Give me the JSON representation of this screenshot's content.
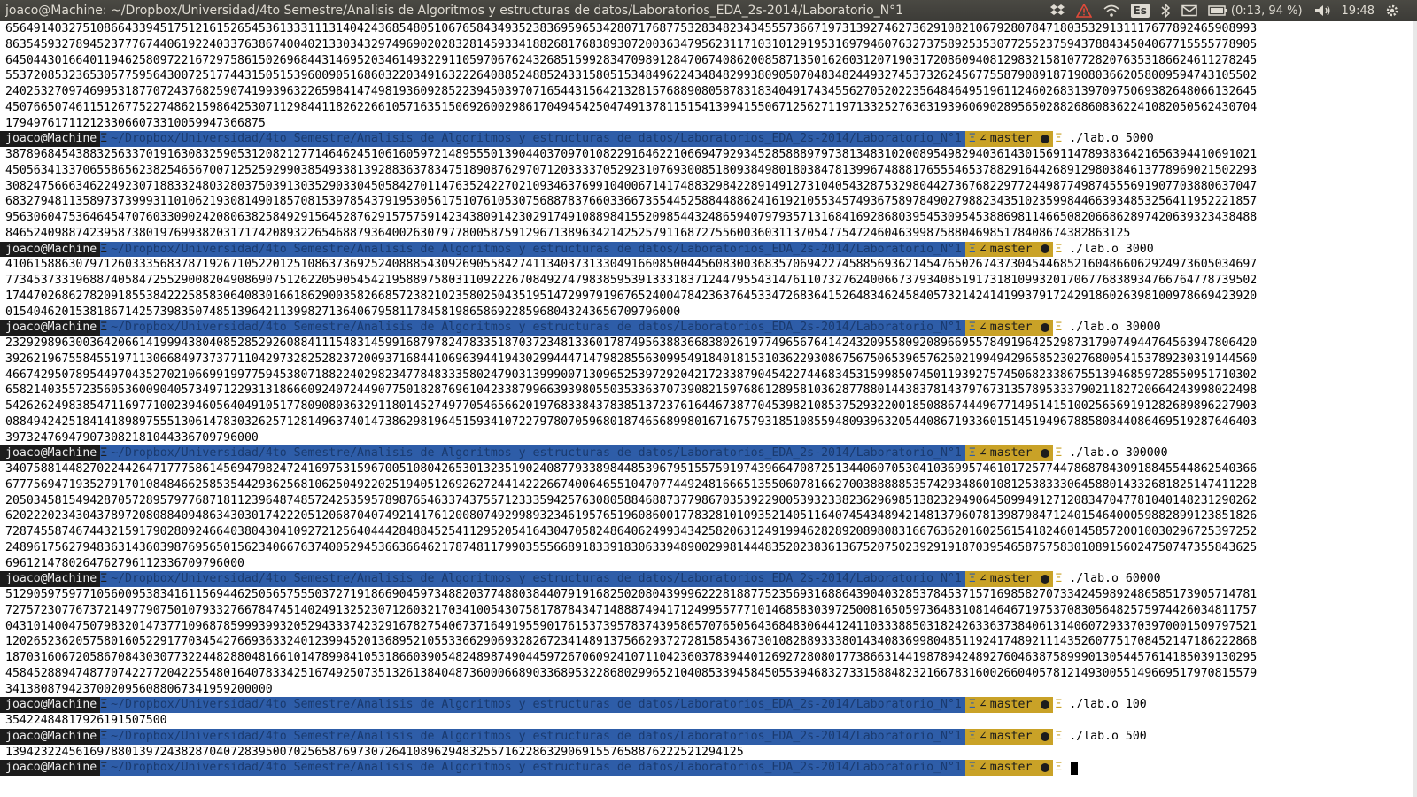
{
  "window": {
    "title": "joaco@Machine: ~/Dropbox/Universidad/4to Semestre/Analisis de Algoritmos y estructuras de datos/Laboratorios_EDA_2s-2014/Laboratorio_N°1"
  },
  "indicators": {
    "keyboard_layout": "Es",
    "battery": "(0:13, 94 %)",
    "clock": "19:48"
  },
  "icons": [
    "dropbox-icon",
    "alert-icon",
    "wifi-icon",
    "keyboard-icon",
    "bluetooth-icon",
    "mail-icon",
    "battery-icon",
    "volume-icon",
    "gear-icon"
  ],
  "colors": {
    "user_segment": "#1c1c1c",
    "path_segment": "#2e5da8",
    "git_segment": "#c9a227"
  },
  "prompt": {
    "user": "joaco@Machine",
    "separator": "Ξ",
    "path": "~/Dropbox/Universidad/4to Semestre/Analisis de Algoritmos y estructuras de datos/Laboratorios_EDA_2s-2014/Laboratorio_N°1",
    "branch": "master",
    "branch_glyph": "∠"
  },
  "terminal": {
    "lines": [
      {
        "type": "output",
        "text": "6564914032751086643394517512161526545361333111314042436854805106765843493523836959653428071768775328348234345557366719731392746273629108210679280784718035329131117677892465908993"
      },
      {
        "type": "output",
        "text": "8635459327894523777674406192240337638674004021330343297496902028328145933418826817683893072003634795623117103101291953169794607632737589253530772552375943788434504067715555778905"
      },
      {
        "type": "output",
        "text": "6450443016640119462580972216729758615026968443146952034614932291105970676243268515992834709891284706740862008587135016260312071903172086094081298321581077282076353186624611278245"
      },
      {
        "type": "output",
        "text": "5537208532365305775956430072517744315051539600905168603220349163222640885248852433158051534849622434848299380905070483482449327453732624567755879089187190803662058009594743105502"
      },
      {
        "type": "output",
        "text": "2402532709746995318770724376825907419939632265984147498193609285223945039707165443156421328157688908058783183404917434556270520223564846495196112460268313970975069382648066132645"
      },
      {
        "type": "output",
        "text": "4507665074611512677522748621598642530711298441182622661057163515069260029861704945425047491378115154139941550671256271197133252763631939606902895650288268608362241082050562430704"
      },
      {
        "type": "output",
        "text": "1794976171121233066073310059947366875"
      },
      {
        "type": "prompt",
        "cmd": "./lab.o 5000"
      },
      {
        "type": "output",
        "text": "3878968454388325633701916308325905312082127714646245106160597214895550139044037097010822916462210669479293452858889797381348310200895498294036143015691147893836421656394410691021"
      },
      {
        "type": "output",
        "text": "4505634133706558656238254656700712525929903854933813928836378347518908762970712033337052923107693008518093849801803847813996748881765554653788291644268912980384613778969021502293"
      },
      {
        "type": "output",
        "text": "3082475666346224923071883324803280375039130352903304505842701147635242270210934637699104006714174883298422891491273104054328753298044273676822977244987749874555691907703880637047"
      },
      {
        "type": "output",
        "text": "6832794811358973739993110106219308149018570815397854379195305617510761053075688783766033667355445258844886241619210553457493675897849027988234351023599844663934853256411952221857"
      },
      {
        "type": "output",
        "text": "9563060475364645470760330902420806382584929156452876291575759142343809142302917491088984155209854432486594079793571316841692868039545309545388698114665082066862897420639323438488"
      },
      {
        "type": "output",
        "text": "8465240988742395873801976993820317174208932265468879364002630797780058759129671389634214252579116872755600360311370547754724604639987588046985178408674382863125"
      },
      {
        "type": "prompt",
        "cmd": "./lab.o 3000"
      },
      {
        "type": "output",
        "text": "4106158863079712603335683787192671052201251086373692524088854309269055842741134037313304916608500445608300368357069422745885693621454765026743730454468521604866062924973605034697"
      },
      {
        "type": "output",
        "text": "7734537331968874058472552900820490869075126220590545421958897580311092226708492747983859539133318371244795543147611073276240066737934085191731810993201706776838934766764778739502"
      },
      {
        "type": "output",
        "text": "1744702686278209185538422258583064083016618629003582668572382102358025043519514729979196765240047842363764533472683641526483462458405732142414199379172429186026398100978669423920"
      },
      {
        "type": "output",
        "text": "015404620153818671425739835074851396421139982713640679581178458198658692285968043243656709796000"
      },
      {
        "type": "prompt",
        "cmd": "./lab.o 30000"
      },
      {
        "type": "output",
        "text": "2329298963003642066141999438040852852926088411154831459916879782478335187037234813360178749563883668380261977496567641424320955809208966955784919642529873179074944764563947806420"
      },
      {
        "type": "output",
        "text": "3926219675584551971130668497373771104297328252823720093716844106963944194302994447147982855630995491840181531036229308675675065396576250219949429658523027680054153789230319144560"
      },
      {
        "type": "output",
        "text": "4667429507895449704352702106699199775945380718822402982347784833358024790313999007130965253972920421723387904542274468345315998507450119392757450682338675513946859728550951710302"
      },
      {
        "type": "output",
        "text": "6582140355723560536009040573497122931318666092407244907750182876961042338799663939805503533637073908215976861289581036287788014438378143797673135789533379021182720664243998022498"
      },
      {
        "type": "output",
        "text": "5426262498385471169771002394605640491051778090803632911801452749770546566201976833843783851372376164467387704539821085375293220018508867444967714951415100256569191282689896227903"
      },
      {
        "type": "output",
        "text": "0884942425184141898975551306147830326257128149637401473862981964515934107227978070596801874656899801671675793185108559480939632054408671933601514519496788580844086469519287646403"
      },
      {
        "type": "output",
        "text": "397324769479073082181044336709796000"
      },
      {
        "type": "prompt",
        "cmd": "./lab.o 300000"
      },
      {
        "type": "output",
        "text": "3407588144827022442647177758614569479824724169753159670051080426530132351902408779338984485396795155759197439664708725134406070530410369957461017257744786878430918845544862540366"
      },
      {
        "type": "output",
        "text": "6777569471935279170108484662585354429362568106250492202519405126926272441422266740064655104707744924816665135506078166270038888853574293486010812538333064588014332681825147411228"
      },
      {
        "type": "output",
        "text": "2050345815494287057289579776871811239648748572425359578987654633743755712333594257630805884688737798670353922900539323382362969851382329490645099491271208347047781040148231290262"
      },
      {
        "type": "output",
        "text": "6202220234304378972080884094863430301742220512068704074921417612008074929989323461957651960860017783281010935214051164074543489421481379607813987984712401546400059882899123851826"
      },
      {
        "type": "output",
        "text": "7287455874674432159179028092466403804304109272125640444284884525411295205416430470582486406249934342582063124919946282892089808316676362016025615418246014585720010030296725397252"
      },
      {
        "type": "output",
        "text": "2489617562794836314360398769565015623406676374005294536636646217874811799035556689183391830633948900299814448352023836136752075023929191870395465875758301089156024750747355843625"
      },
      {
        "type": "output",
        "text": "6961214780264762796112336709796000"
      },
      {
        "type": "prompt",
        "cmd": "./lab.o 60000"
      },
      {
        "type": "output",
        "text": "5129059759771056009538341611569446250565755503727191866904597348820377488038440791916825020804399962228188775235693168864390403285378453715716985827073342459892486585173905714781"
      },
      {
        "type": "output",
        "text": "7275723077673721497790750107933276678474514024913252307126032170341005430758178784347148887494171249955777101468583039725008165059736483108146467197537083056482575974426034811757"
      },
      {
        "type": "output",
        "text": "0431014004750798320147377109687859993993205294333742329167827540673716491955901761537395783743958657076505643684830644124110333885031824263363738406131406072933703970001509797521"
      },
      {
        "type": "output",
        "text": "1202652362057580160522917703454276693633240123994520136895210553366290693282672341489137566293727281585436730108288933380143408369980485119241748921114352607751708452147186222868"
      },
      {
        "type": "output",
        "text": "1870316067205867084303077322448288048166101478998410531866039054824898749044597267060924107110423603783944012692728080177386631441987894248927604638758999013054457614185039130295"
      },
      {
        "type": "output",
        "text": "4584528894748770742277204225548016407833425167492507351326138404873600066890336895322868029965210408533945845055394683273315884823216678316002660405781214930055149669517970815579"
      },
      {
        "type": "output",
        "text": "34138087942370020956088067341959200000"
      },
      {
        "type": "prompt",
        "cmd": "./lab.o 100"
      },
      {
        "type": "output",
        "text": "35422484817926191507500"
      },
      {
        "type": "prompt",
        "cmd": "./lab.o 500"
      },
      {
        "type": "output",
        "text": "139423224561697880139724382870407283950070256587697307264108962948325571622863290691557658876222521294125"
      },
      {
        "type": "prompt",
        "cmd": "",
        "cursor": true
      }
    ]
  }
}
